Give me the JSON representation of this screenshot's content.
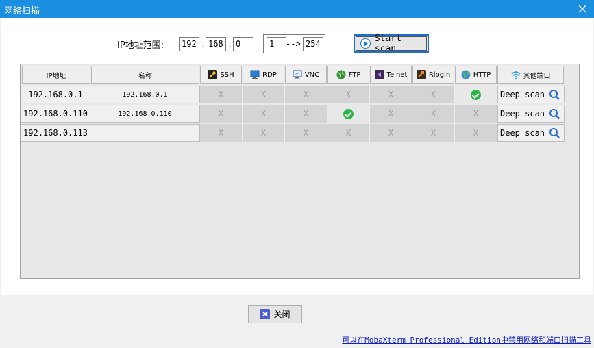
{
  "window": {
    "title": "网络扫描"
  },
  "scan": {
    "range_label": "IP地址范围:",
    "ip_octets": [
      "192",
      "168",
      "0"
    ],
    "range_start": "1",
    "range_arrow": "-->",
    "range_end": "254",
    "start_button": "Start scan"
  },
  "table": {
    "headers": {
      "ip": "IP地址",
      "name": "名称",
      "ports": [
        "SSH",
        "RDP",
        "VNC",
        "FTP",
        "Telnet",
        "Rlogin",
        "HTTP"
      ],
      "other": "其他端口"
    },
    "rows": [
      {
        "ip": "192.168.0.1",
        "name": "192.168.0.1",
        "ports": [
          "X",
          "X",
          "X",
          "X",
          "X",
          "X",
          "ok"
        ],
        "deep": "Deep scan"
      },
      {
        "ip": "192.168.0.110",
        "name": "192.168.0.110",
        "ports": [
          "X",
          "X",
          "X",
          "ok",
          "X",
          "X",
          "X"
        ],
        "deep": "Deep scan"
      },
      {
        "ip": "192.168.0.113",
        "name": "",
        "ports": [
          "X",
          "X",
          "X",
          "X",
          "X",
          "X",
          "X"
        ],
        "deep": "Deep scan"
      }
    ]
  },
  "footer": {
    "close_button": "关闭",
    "link": "可以在MobaXterm Professional Edition中禁用网络和端口扫描工具"
  },
  "icons": {
    "ssh": "key-icon",
    "rdp": "monitor-icon",
    "vnc": "vnc-screen-icon",
    "ftp": "globe-icon",
    "telnet": "telnet-icon",
    "rlogin": "rlogin-icon",
    "http": "earth-icon",
    "other": "wifi-icon"
  },
  "colors": {
    "titlebar": "#1a8fe0",
    "ok": "#2db54a",
    "link": "#1020c0"
  }
}
